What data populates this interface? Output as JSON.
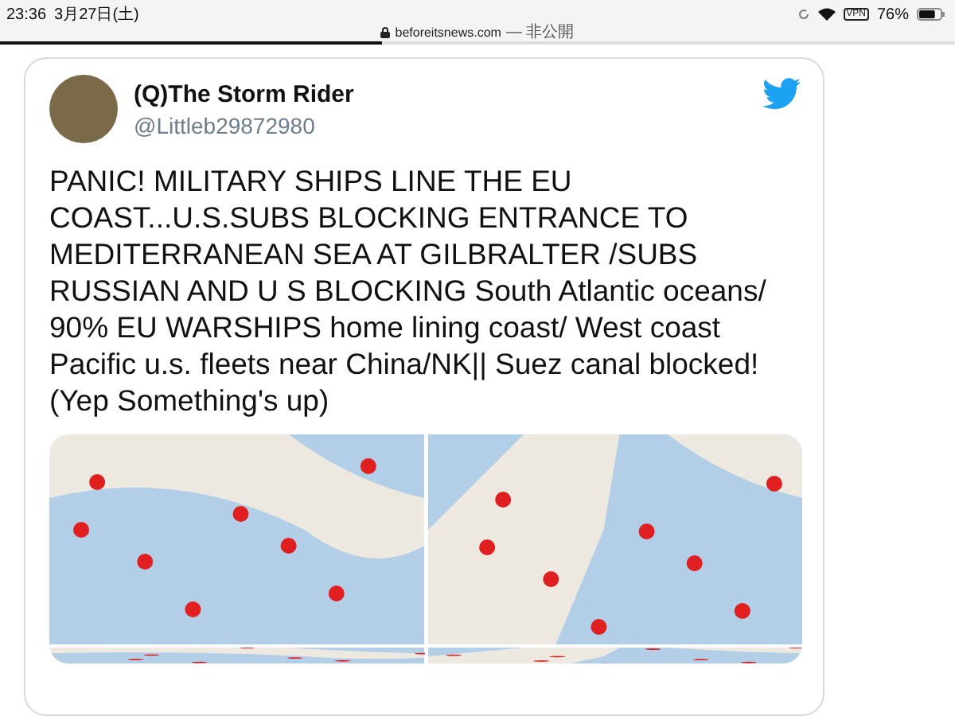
{
  "status_bar": {
    "time": "23:36",
    "date": "3月27日(土)",
    "vpn": "VPN",
    "battery": "76%",
    "level": 0.76
  },
  "address_bar": {
    "domain": "beforeitsnews.com",
    "note": "— 非公開",
    "level": 0.4
  },
  "tweet": {
    "name": "(Q)The Storm Rider",
    "handle": "@Littleb29872980",
    "text": "PANIC! MILITARY SHIPS LINE THE EU COAST...U.S.SUBS BLOCKING ENTRANCE TO MEDITERRANEAN SEA AT GILBRALTER /SUBS RUSSIAN AND U S BLOCKING South Atlantic oceans/ 90% EU WARSHIPS home lining coast/ West coast Pacific u.s. fleets near China/NK|| Suez canal blocked! (Yep Something's up)"
  }
}
